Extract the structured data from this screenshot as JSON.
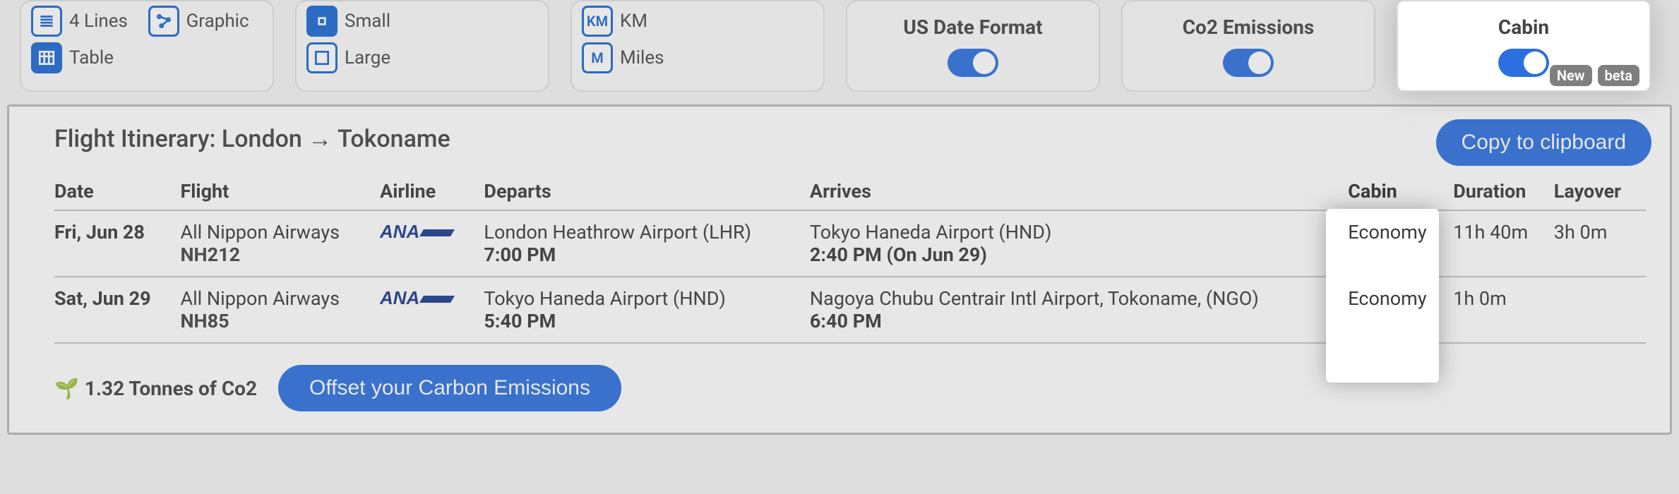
{
  "toolbar": {
    "view": {
      "lines4": "4 Lines",
      "graphic": "Graphic",
      "table": "Table"
    },
    "size": {
      "small": "Small",
      "large": "Large"
    },
    "units": {
      "km_badge": "KM",
      "km": "KM",
      "m_badge": "M",
      "miles": "Miles"
    },
    "toggles": {
      "us_date": "US Date Format",
      "co2": "Co2 Emissions",
      "cabin": "Cabin",
      "new_badge": "New",
      "beta_badge": "beta"
    }
  },
  "actions": {
    "copy": "Copy to clipboard",
    "offset": "Offset your Carbon Emissions"
  },
  "itinerary": {
    "title": "Flight Itinerary: London → Tokoname",
    "headers": {
      "date": "Date",
      "flight": "Flight",
      "airline": "Airline",
      "departs": "Departs",
      "arrives": "Arrives",
      "cabin": "Cabin",
      "duration": "Duration",
      "layover": "Layover"
    },
    "rows": [
      {
        "date": "Fri, Jun 28",
        "carrier": "All Nippon Airways",
        "flight_no": "NH212",
        "airline_code": "ANA",
        "dep_airport": "London Heathrow Airport (LHR)",
        "dep_time": "7:00 PM",
        "arr_airport": "Tokyo Haneda Airport (HND)",
        "arr_time": "2:40 PM (On Jun 29)",
        "cabin": "Economy",
        "duration": "11h 40m",
        "layover": "3h 0m"
      },
      {
        "date": "Sat, Jun 29",
        "carrier": "All Nippon Airways",
        "flight_no": "NH85",
        "airline_code": "ANA",
        "dep_airport": "Tokyo Haneda Airport (HND)",
        "dep_time": "5:40 PM",
        "arr_airport": "Nagoya Chubu Centrair Intl Airport, Tokoname, (NGO)",
        "arr_time": "6:40 PM",
        "cabin": "Economy",
        "duration": "1h 0m",
        "layover": ""
      }
    ]
  },
  "co2": {
    "amount": "1.32 Tonnes of Co2",
    "icon": "🌱"
  }
}
